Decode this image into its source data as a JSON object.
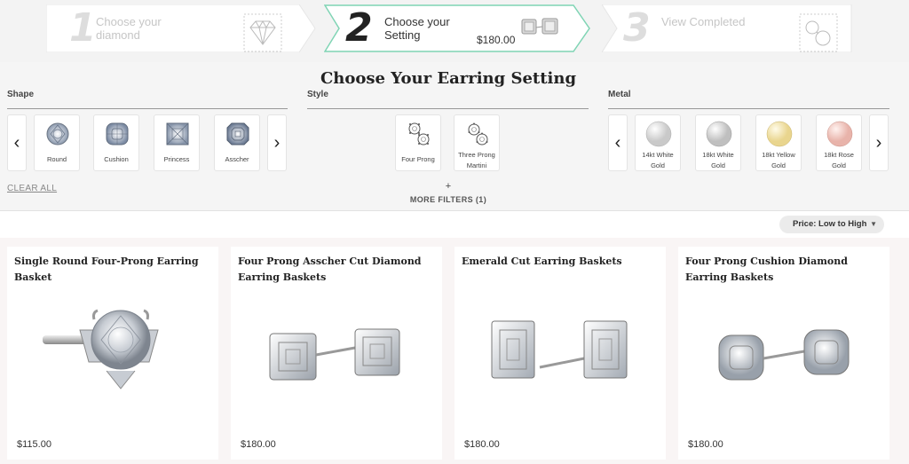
{
  "stepper": {
    "step1": {
      "number": "1",
      "label": "Choose your diamond"
    },
    "step2": {
      "number": "2",
      "label": "Choose your Setting",
      "price": "$180.00"
    },
    "step3": {
      "number": "3",
      "label": "View Completed"
    }
  },
  "filters": {
    "title": "Choose Your Earring Setting",
    "shape": {
      "heading": "Shape",
      "items": [
        {
          "label": "Round",
          "icon": "round-diamond-icon"
        },
        {
          "label": "Cushion",
          "icon": "cushion-diamond-icon"
        },
        {
          "label": "Princess",
          "icon": "princess-diamond-icon"
        },
        {
          "label": "Asscher",
          "icon": "asscher-diamond-icon"
        }
      ]
    },
    "style": {
      "heading": "Style",
      "items": [
        {
          "label": "Four Prong",
          "icon": "four-prong-icon"
        },
        {
          "label": "Three Prong Martini",
          "icon": "three-prong-martini-icon"
        }
      ]
    },
    "metal": {
      "heading": "Metal",
      "items": [
        {
          "label": "14kt White Gold",
          "color": "#c9c9c9"
        },
        {
          "label": "18kt White Gold",
          "color": "#bfbfbf"
        },
        {
          "label": "18kt Yellow Gold",
          "color": "#e9d58e"
        },
        {
          "label": "18kt Rose Gold",
          "color": "#e8b3aa"
        }
      ]
    },
    "clear_all": "CLEAR ALL",
    "more_plus": "+",
    "more_filters": "MORE FILTERS (1)"
  },
  "sort": {
    "label": "Price: Low to High"
  },
  "products": [
    {
      "title": "Single Round Four-Prong Earring Basket",
      "price": "$115.00"
    },
    {
      "title": "Four Prong Asscher Cut Diamond Earring Baskets",
      "price": "$180.00"
    },
    {
      "title": "Emerald Cut Earring Baskets",
      "price": "$180.00"
    },
    {
      "title": "Four Prong Cushion Diamond Earring Baskets",
      "price": "$180.00"
    }
  ]
}
